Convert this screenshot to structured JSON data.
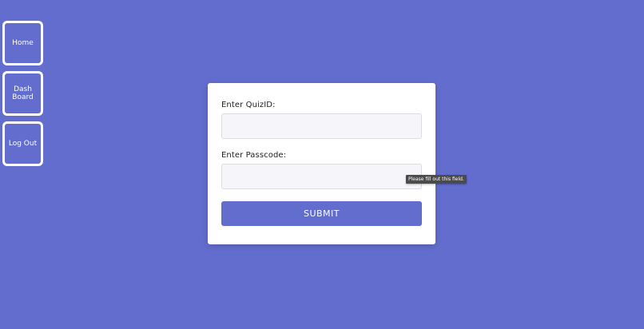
{
  "theme": {
    "background": "#636dce",
    "accent": "#636dce"
  },
  "sidebar": {
    "items": [
      {
        "label": "Home"
      },
      {
        "label": "Dash\nBoard"
      },
      {
        "label": "Log Out"
      }
    ]
  },
  "form": {
    "quiz_id_label": "Enter QuizID:",
    "quiz_id_value": "",
    "passcode_label": "Enter Passcode:",
    "passcode_value": "",
    "submit_label": "SUBMIT"
  },
  "validation": {
    "tooltip_text": "Please fill out this field."
  }
}
